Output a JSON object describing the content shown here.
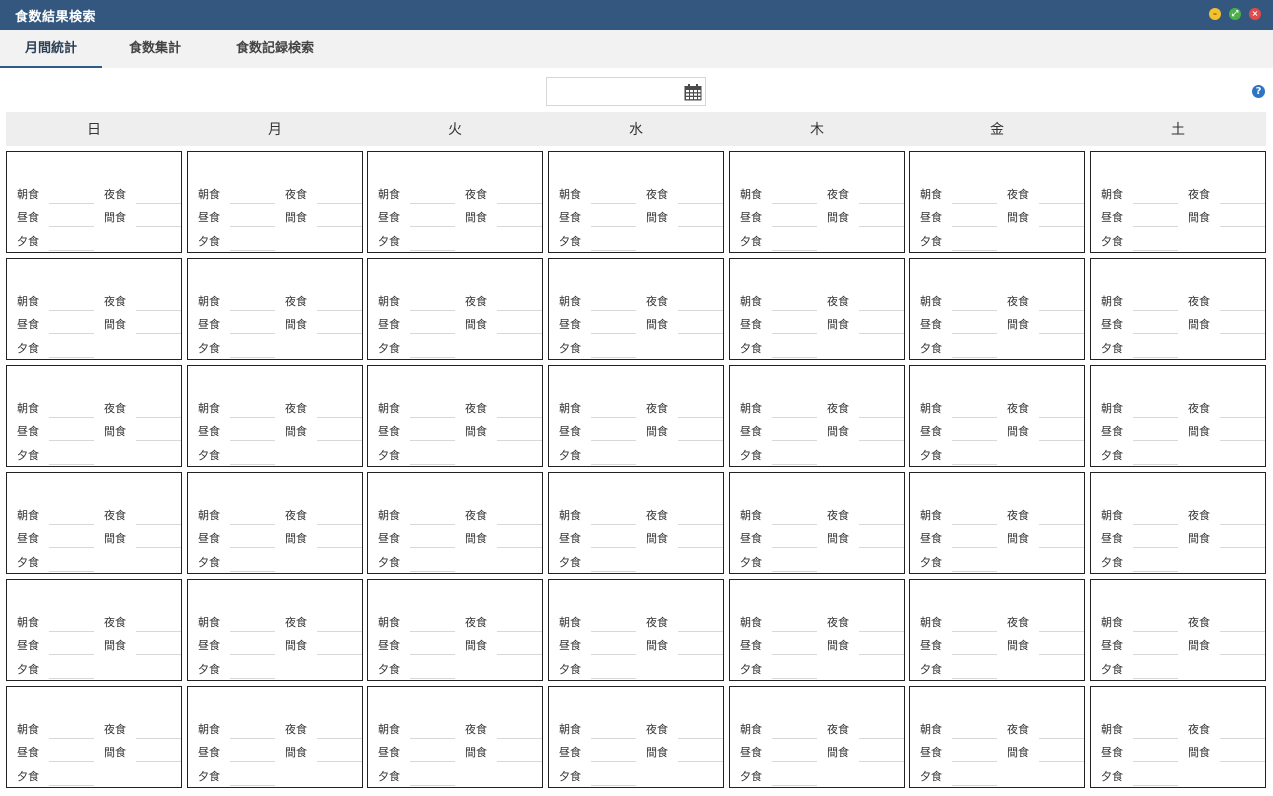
{
  "app": {
    "title": "食数結果検索"
  },
  "window_controls": {
    "minimize": "–",
    "maximize": "⤢",
    "close": "×"
  },
  "tabs": [
    {
      "label": "月間統計",
      "active": true
    },
    {
      "label": "食数集計",
      "active": false
    },
    {
      "label": "食数記録検索",
      "active": false
    }
  ],
  "date_field": {
    "value": "",
    "placeholder": ""
  },
  "help": {
    "label": "?"
  },
  "weekdays": [
    "日",
    "月",
    "火",
    "水",
    "木",
    "金",
    "土"
  ],
  "meal_labels": {
    "breakfast": "朝食",
    "night": "夜食",
    "lunch": "昼食",
    "snack": "間食",
    "dinner": "夕食"
  },
  "calendar": {
    "rows": 6,
    "cols": 7
  },
  "colors": {
    "titlebar": "#34577f",
    "accent": "#2e5b8a",
    "help": "#2d74c4"
  }
}
